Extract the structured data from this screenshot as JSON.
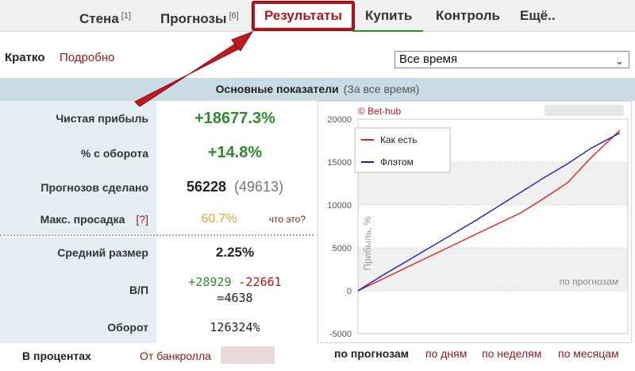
{
  "nav": {
    "wall": "Стена",
    "wall_count": "[1]",
    "forecasts": "Прогнозы",
    "forecasts_count": "[6]",
    "results": "Результаты",
    "buy": "Купить",
    "control": "Контроль",
    "more": "Ещё.."
  },
  "sub": {
    "short": "Кратко",
    "detailed": "Подробно",
    "period": "Все время"
  },
  "panel": {
    "title": "Основные показатели",
    "subtitle": "(За все время)"
  },
  "stats": {
    "net_profit_label": "Чистая прибыль",
    "net_profit_value": "+18677.3%",
    "turnover_pct_label": "% с оборота",
    "turnover_pct_value": "+14.8%",
    "forecasts_made_label": "Прогнозов сделано",
    "forecasts_made_value": "56228",
    "forecasts_made_extra": "(49613)",
    "max_drawdown_label": "Макс. просадка",
    "max_drawdown_hint": "[?]",
    "max_drawdown_value": "60.7%",
    "what_is": "что это?",
    "avg_size_label": "Средний размер",
    "avg_size_value": "2.25%",
    "wl_label": "В/П",
    "wl_wins": "+28929",
    "wl_losses": "-22661",
    "wl_net": "=4638",
    "turnover_label": "Оборот",
    "turnover_value": "126324%"
  },
  "bottom": {
    "in_percent": "В процентах",
    "from_bankroll": "От банкролла",
    "by_forecasts": "по прогнозам",
    "by_days": "по дням",
    "by_weeks": "по неделям",
    "by_months": "по месяцам"
  },
  "colors": {
    "accent_red": "#b4151b",
    "link": "#8b1a1a",
    "profit_green": "#2e8b2e",
    "drawdown_orange": "#e8a33a",
    "label_bg": "#e5eff3",
    "header_bg": "#c9dce3",
    "series_as_is": "#e02020",
    "series_flat": "#1a1ac8"
  },
  "chart_data": {
    "type": "line",
    "watermark": "© Bet-hub",
    "ylabel": "Прибыль, %",
    "xlabel": "по прогнозам",
    "ylim": [
      -5000,
      20000
    ],
    "yticks": [
      20000,
      15000,
      10000,
      5000,
      0,
      -5000
    ],
    "ytick_labels": [
      "20000",
      "15000",
      "10000",
      "5000",
      "0",
      "-5000"
    ],
    "x": [
      0,
      5000,
      10000,
      15000,
      20000,
      25000,
      30000,
      35000,
      40000,
      45000,
      50000,
      56228
    ],
    "series": [
      {
        "name": "Как есть",
        "values": [
          0,
          1300,
          2600,
          3900,
          5200,
          6500,
          7800,
          9100,
          10800,
          12600,
          15500,
          18700
        ]
      },
      {
        "name": "Флэтом",
        "values": [
          0,
          1700,
          3300,
          4900,
          6500,
          8100,
          9800,
          11500,
          13200,
          14800,
          16600,
          18400
        ]
      }
    ],
    "legend": "top-left",
    "grid": true
  }
}
